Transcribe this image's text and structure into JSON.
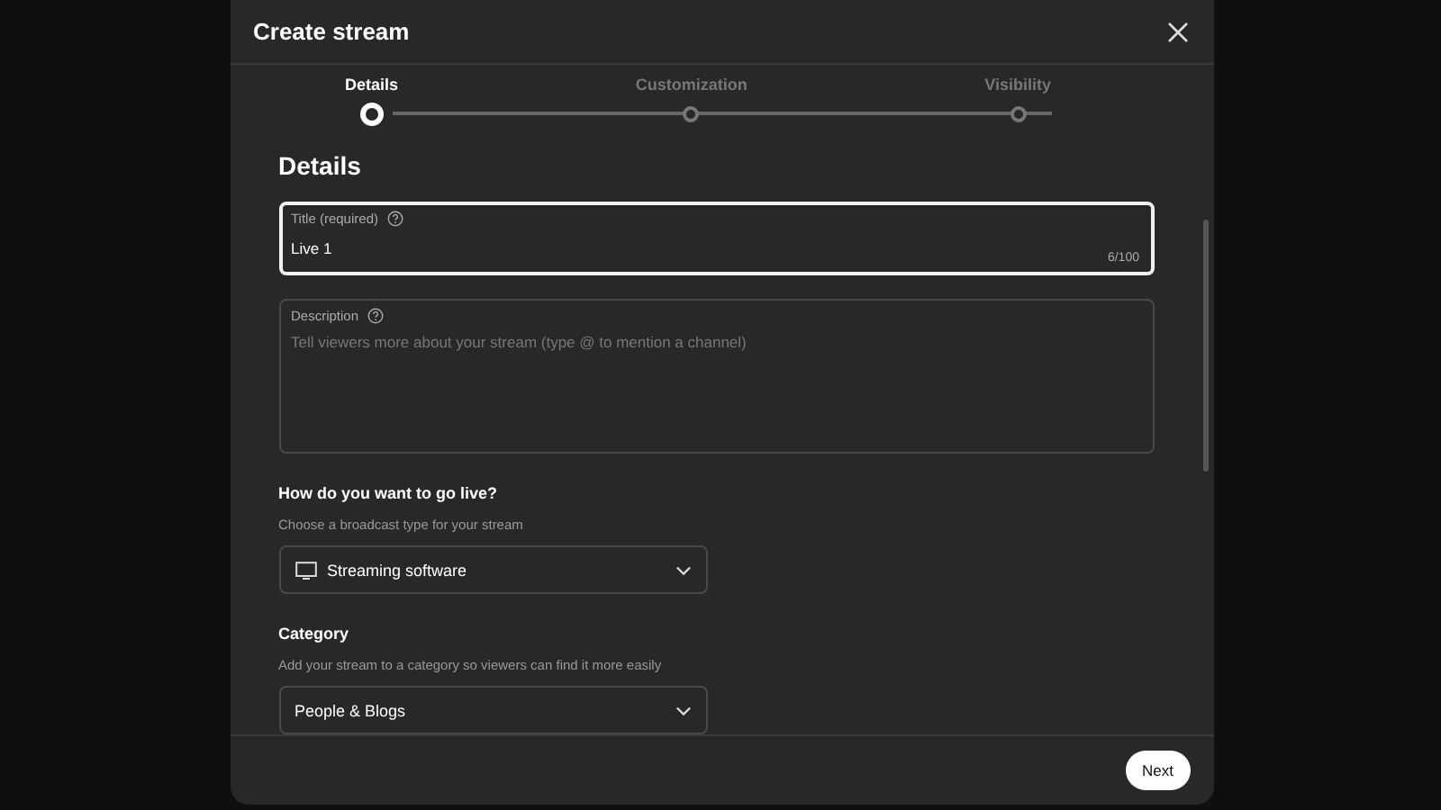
{
  "dialog": {
    "title": "Create stream"
  },
  "steps": [
    {
      "label": "Details",
      "selected": true
    },
    {
      "label": "Customization",
      "selected": false
    },
    {
      "label": "Visibility",
      "selected": false
    }
  ],
  "section_title": "Details",
  "title_field": {
    "label": "Title (required)",
    "value": "Live 1",
    "counter": "6/100",
    "focused": true
  },
  "description_field": {
    "label": "Description",
    "placeholder": "Tell viewers more about your stream (type @ to mention a channel)"
  },
  "go_live": {
    "heading": "How do you want to go live?",
    "hint": "Choose a broadcast type for your stream",
    "value": "Streaming software"
  },
  "category": {
    "heading": "Category",
    "hint": "Add your stream to a category so viewers can find it more easily",
    "value": "People & Blogs"
  },
  "footer": {
    "next": "Next"
  }
}
